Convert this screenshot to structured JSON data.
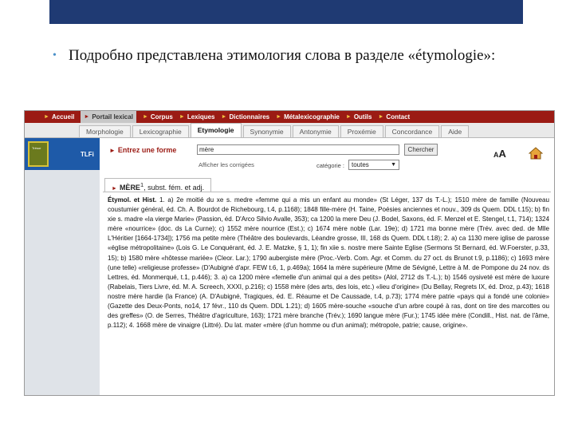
{
  "slide": {
    "bullet_text": "Подробно представлена этимология слова в разделе «étymologie»:"
  },
  "menu": {
    "items": [
      {
        "label": "Accueil"
      },
      {
        "label": "Portail lexical"
      },
      {
        "label": "Corpus"
      },
      {
        "label": "Lexiques"
      },
      {
        "label": "Dictionnaires"
      },
      {
        "label": "Métalexicographie"
      },
      {
        "label": "Outils"
      },
      {
        "label": "Contact"
      }
    ]
  },
  "subtabs": [
    {
      "label": "Morphologie"
    },
    {
      "label": "Lexicographie"
    },
    {
      "label": "Etymologie"
    },
    {
      "label": "Synonymie"
    },
    {
      "label": "Antonymie"
    },
    {
      "label": "Proxémie"
    },
    {
      "label": "Concordance"
    },
    {
      "label": "Aide"
    }
  ],
  "logo": {
    "text": "TLFi",
    "book_text": "Trésor"
  },
  "search": {
    "label": "Entrez une forme",
    "value": "mère",
    "button": "Chercher",
    "fix_link": "Afficher les corrigées",
    "category_label": "catégorie :",
    "category_value": "toutes",
    "font_small": "A",
    "font_big": "A"
  },
  "entry": {
    "tab_headword": "MÈRE",
    "tab_sup": "1",
    "tab_rest": ", subst. fém. et adj.",
    "heading": "Étymol. et Hist.",
    "body": " 1. a) 2e moitié du xe s. medre «femme qui a mis un enfant au monde» (St Léger, 137 ds T.-L.); 1510 mère de famille (Nouveau coustumier général, éd. Ch. A. Bourdot de Richebourg, t.4, p.1168); 1848 fille-mère (H. Taine, Poésies anciennes et nouv., 309 ds Quem. DDL t.15); b) fin xie s. madre «la vierge Marie» (Passion, éd. D'Arco Silvio Avalle, 353); ca 1200 la mere Deu (J. Bodel, Saxons, éd. F. Menzel et E. Stengel, t.1, 714); 1324 mère «nourrice» (doc. ds La Curne); c) 1552 mère nourrice (Est.); c) 1674 mère noble (Lar. 19e); d) 1721 ma bonne mère (Trév. avec ded. de Mlle L'Héritier [1664-1734]); 1756 ma petite mère (Théâtre des boulevards, Léandre grosse, III, 168 ds Quem. DDL t.18); 2. a) ca 1130 mere iglise de parosse «église métropolitaine» (Lois G. Le Conquérant, éd. J. E. Matzke, § 1, 1); fin xiie s. nostre mere Sainte Eglise (Sermons St Bernard, éd. W.Foerster, p.33, 15); b) 1580 mère «hôtesse mariée» (Cleor. Lar.); 1790 aubergiste mère (Proc.-Verb. Com. Agr. et Comm. du 27 oct. ds Brunot t.9, p.1186); c) 1693 mère (une telle) «religieuse professe» (D'Aubigné d'apr. FEW t.6, 1, p.469a); 1664 la mère supérieure (Mme de Sévigné, Lettre à M. de Pompone du 24 nov. ds Lettres, éd. Monmerqué, t.1, p.446); 3. a) ca 1200 mère «femelle d'un animal qui a des petits» (Alol, 2712 ds T.-L.); b) 1546 oysiveté est mère de luxure (Rabelais, Tiers Livre, éd. M. A. Screech, XXXI, p.216); c) 1558 mère (des arts, des lois, etc.) «lieu d'origine» (Du Bellay, Regrets IX, éd. Droz, p.43); 1618 nostre mère hardie (la France) (A. D'Aubigné, Tragiques, éd. E. Réaume et De Caussade, t.4, p.73); 1774 mère patrie «pays qui a fondé une colonie» (Gazette des Deux-Ponts, no14, 17 févr., 110 ds Quem. DDL 1.21); d) 1605 mère-souche «souche d'un arbre coupé à ras, dont on tire des marcottes ou des greffes» (O. de Serres, Théâtre d'agriculture, 163); 1721 mère branche (Trév.); 1690 langue mère (Fur.); 1745 idée mère (Condill., Hist. nat. de l'âme, p.112); 4. 1668 mère de vinaigre (Littré). Du lat. mater «mère (d'un homme ou d'un animal); métropole, patrie; cause, origine»."
  }
}
